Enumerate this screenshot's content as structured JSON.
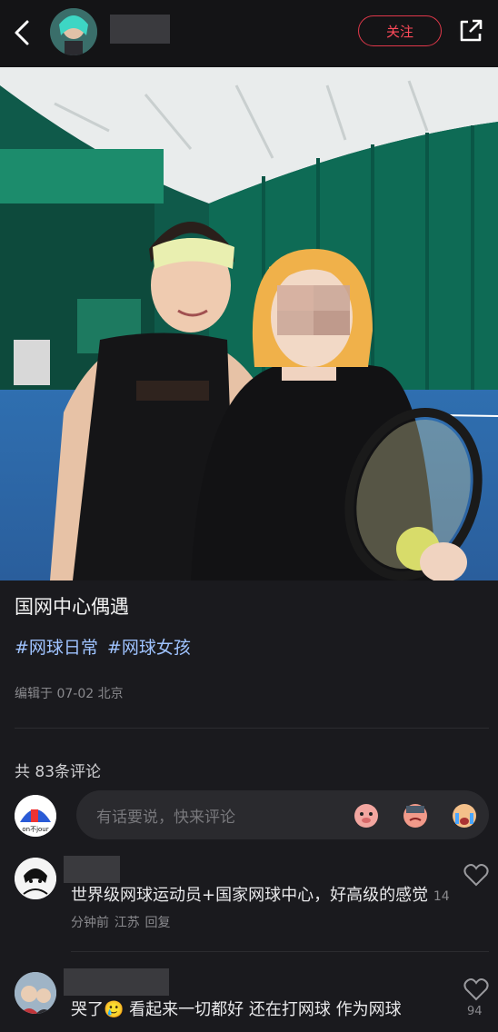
{
  "header": {
    "follow_label": "关注"
  },
  "post": {
    "title": "国网中心偶遇",
    "tags": [
      "#网球日常",
      "#网球女孩"
    ],
    "meta": "编辑于 07-02 北京"
  },
  "comments_section": {
    "count_label": "共 83条评论",
    "input_placeholder": "有话要说，快来评论",
    "my_avatar_text": "on不jour"
  },
  "comments": [
    {
      "text": "世界级网球运动员+国家网球中心，好高级的感觉",
      "time": "14分钟前",
      "location": "江苏",
      "reply": "回复"
    },
    {
      "text": "哭了🥲 看起来一切都好 还在打网球 作为网球",
      "likes": "94"
    }
  ],
  "colors": {
    "accent": "#e0384a",
    "tag": "#9fc3ff",
    "background": "#1a1a1e"
  }
}
